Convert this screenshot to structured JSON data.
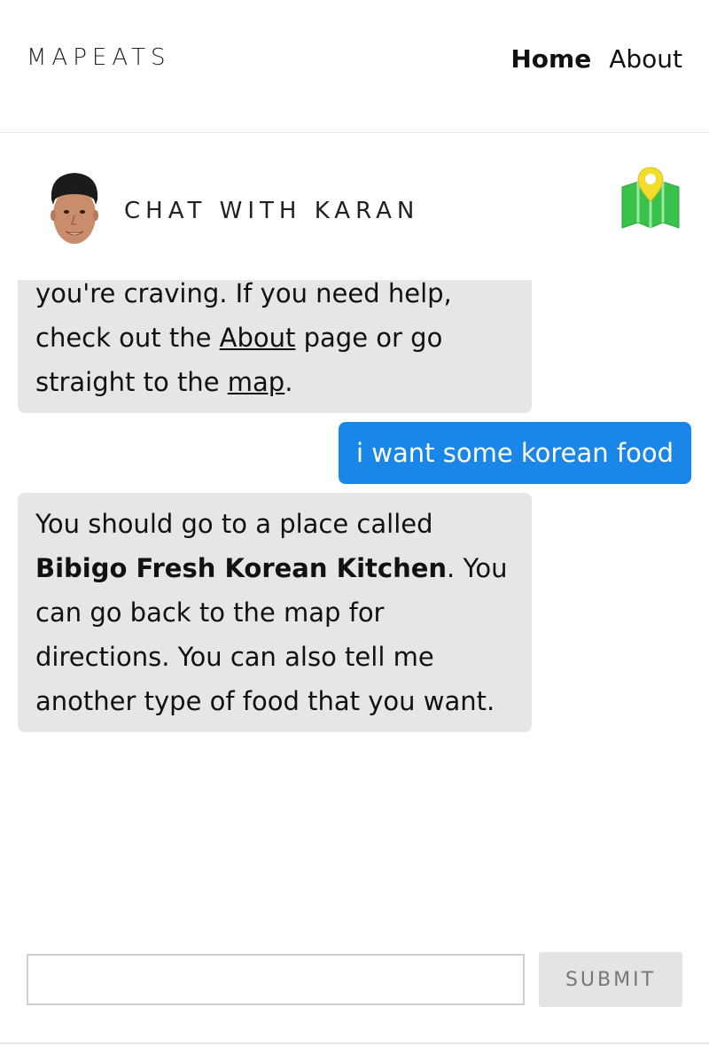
{
  "header": {
    "brand": "MAPEATS",
    "nav": [
      {
        "label": "Home",
        "active": true
      },
      {
        "label": "About",
        "active": false
      }
    ]
  },
  "chat": {
    "title": "CHAT WITH KARAN",
    "map_icon": "map-pin-icon",
    "messages": [
      {
        "from": "bot",
        "line1": "you're craving. If you need help,",
        "pre_about": "check out the ",
        "about_link": "About",
        "post_about": " page or go",
        "pre_map": "straight to the ",
        "map_link": "map",
        "post_map": "."
      },
      {
        "from": "user",
        "text": "i want some korean food"
      },
      {
        "from": "bot",
        "pre": "You should go to a place called ",
        "restaurant": "Bibigo Fresh Korean Kitchen",
        "post": ". You can go back to the map for directions. You can also tell me another type of food that you want."
      }
    ]
  },
  "composer": {
    "value": "",
    "placeholder": "",
    "submit_label": "SUBMIT"
  },
  "colors": {
    "user_bubble": "#1a86e8",
    "bot_bubble": "#e6e6e6",
    "map_green": "#39c24a",
    "pin_yellow": "#f2dc2c"
  }
}
